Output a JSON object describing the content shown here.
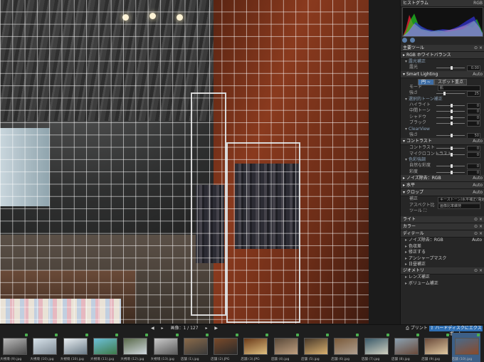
{
  "panel": {
    "histogram_title": "ヒストグラム",
    "histogram_mode": "RGB",
    "tools_title": "主要ツール",
    "rows": [
      {
        "kind": "bar",
        "label": "RGB ホワイトバランス",
        "tri": "▸"
      },
      {
        "kind": "head",
        "label": "露光補正",
        "tri": "▾"
      },
      {
        "kind": "slider",
        "label": "露光",
        "value": "0.00",
        "pos": 0.5
      },
      {
        "kind": "bar",
        "label": "Smart Lighting",
        "right": "Auto",
        "tri": "▾"
      },
      {
        "kind": "btns",
        "items": [
          "円 ~",
          "スポット重点"
        ],
        "on": 0
      },
      {
        "kind": "dd",
        "label": "モード",
        "value": "肌"
      },
      {
        "kind": "slider",
        "label": "強さ",
        "value": "25",
        "pos": 0.25
      },
      {
        "kind": "head",
        "label": "選択的トーン補正",
        "tri": "▾"
      },
      {
        "kind": "slider",
        "label": "ハイライト",
        "value": "0",
        "pos": 0.5
      },
      {
        "kind": "slider",
        "label": "中間トーン",
        "value": "0",
        "pos": 0.5
      },
      {
        "kind": "slider",
        "label": "シャドウ",
        "value": "0",
        "pos": 0.5
      },
      {
        "kind": "slider",
        "label": "ブラック",
        "value": "0",
        "pos": 0.5
      },
      {
        "kind": "head",
        "label": "ClearView",
        "tri": "▾"
      },
      {
        "kind": "slider",
        "label": "強さ",
        "value": "50",
        "pos": 0.5
      },
      {
        "kind": "bar",
        "label": "コントラスト",
        "right": "Auto",
        "tri": "▾"
      },
      {
        "kind": "slider",
        "label": "コントラスト",
        "value": "0",
        "pos": 0.5
      },
      {
        "kind": "slider",
        "label": "マイクロコントラスト",
        "value": "0",
        "pos": 0.5
      },
      {
        "kind": "head",
        "label": "色彩強調",
        "tri": "▾"
      },
      {
        "kind": "slider",
        "label": "自然な彩度",
        "value": "0",
        "pos": 0.5
      },
      {
        "kind": "slider",
        "label": "彩度",
        "value": "0",
        "pos": 0.5
      },
      {
        "kind": "bar",
        "label": "ノイズ除去：RGB",
        "right": "Auto",
        "tri": "▸"
      },
      {
        "kind": "bar",
        "label": "水平",
        "right": "Auto",
        "tri": "▸"
      },
      {
        "kind": "bar",
        "label": "クロップ",
        "right": "Auto",
        "tri": "▾"
      },
      {
        "kind": "dd",
        "label": "補正",
        "value": "キーストーン/水平補正(保定値)"
      },
      {
        "kind": "dd",
        "label": "アスペクト比",
        "value": "画像比率維持"
      },
      {
        "kind": "row",
        "label": "ツール",
        "value": "⛶"
      }
    ],
    "sections": [
      {
        "label": "ライト"
      },
      {
        "label": "カラー"
      },
      {
        "label": "ディテール"
      }
    ],
    "detail_rows": [
      {
        "label": "ノイズ除去：RGB",
        "right": "Auto"
      },
      {
        "label": "色収差"
      },
      {
        "label": "修正する"
      },
      {
        "label": "アンシャープマスク"
      },
      {
        "label": "日昼補正"
      }
    ],
    "geometry_title": "ジオメトリ",
    "geometry_rows": [
      {
        "label": "レンズ補正"
      },
      {
        "label": "ボリューム補正"
      }
    ]
  },
  "strip": {
    "counter": "画像：1 / 127",
    "print_label": "プリント",
    "export_label": "ハードディスクにエクスポート",
    "thumbs": [
      {
        "cap": "大視境 (9).jpg",
        "c1": "#b9b9b9",
        "c2": "#4a4a4a"
      },
      {
        "cap": "大視境 (10).jpg",
        "c1": "#d7e2ea",
        "c2": "#7e8a94"
      },
      {
        "cap": "大視境 (10).jpg",
        "c1": "#e8eef2",
        "c2": "#6a7a86"
      },
      {
        "cap": "大視境 (11).jpg",
        "c1": "#6cc0d8",
        "c2": "#3f7a4a"
      },
      {
        "cap": "大視境 (12).jpg",
        "c1": "#5a6a4a",
        "c2": "#cfd7de"
      },
      {
        "cap": "大視境 (13).jpg",
        "c1": "#c9c9c9",
        "c2": "#5b5b5b"
      },
      {
        "cap": "店舗 (1).jpg",
        "c1": "#8a6a4a",
        "c2": "#3a3a3a"
      },
      {
        "cap": "店舗 (2).JPG",
        "c1": "#7a4a2a",
        "c2": "#2a2a2a"
      },
      {
        "cap": "店舗 (3).JPG",
        "c1": "#6a3a1a",
        "c2": "#e0c080"
      },
      {
        "cap": "店舗 (4).jpg",
        "c1": "#5a4a3a",
        "c2": "#c0a080"
      },
      {
        "cap": "店舗 (5).jpg",
        "c1": "#4a3a2a",
        "c2": "#d8b070"
      },
      {
        "cap": "店舗 (6).jpg",
        "c1": "#7a5a3a",
        "c2": "#b0a090"
      },
      {
        "cap": "店舗 (7).jpg",
        "c1": "#3a5a6a",
        "c2": "#d0d0c0"
      },
      {
        "cap": "店舗 (8).jpg",
        "c1": "#8aa0b0",
        "c2": "#6a4a3a"
      },
      {
        "cap": "店舗 (9).jpg",
        "c1": "#6a4a3a",
        "c2": "#e0c8a0"
      },
      {
        "cap": "店舗 (10).jpg",
        "c1": "#4a6a8a",
        "c2": "#8a4a2a",
        "sel": true
      }
    ]
  }
}
